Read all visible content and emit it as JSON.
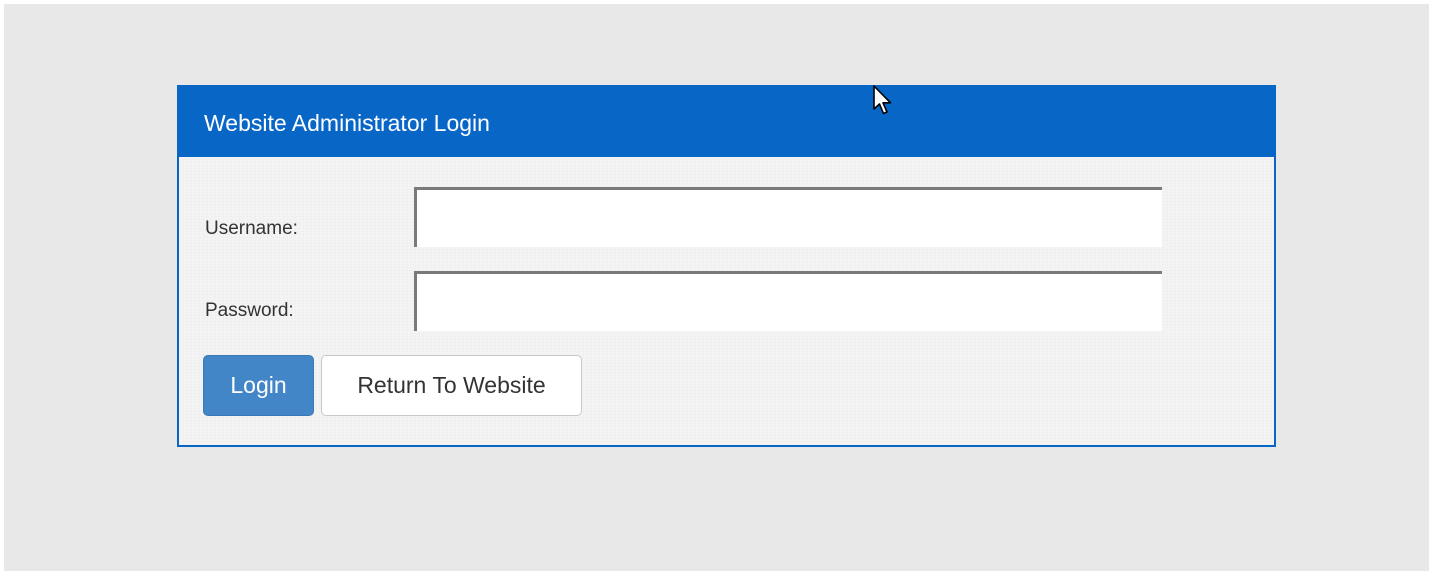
{
  "login_panel": {
    "title": "Website Administrator Login",
    "username": {
      "label": "Username:",
      "value": ""
    },
    "password": {
      "label": "Password:",
      "value": ""
    },
    "login_button_label": "Login",
    "return_button_label": "Return To Website"
  },
  "colors": {
    "header_blue": "#0866c6",
    "login_button": "#4286c8",
    "page_background": "#e8e8e8",
    "panel_background": "#f4f4f4"
  },
  "icons": {
    "cursor": "mouse-pointer-icon"
  }
}
